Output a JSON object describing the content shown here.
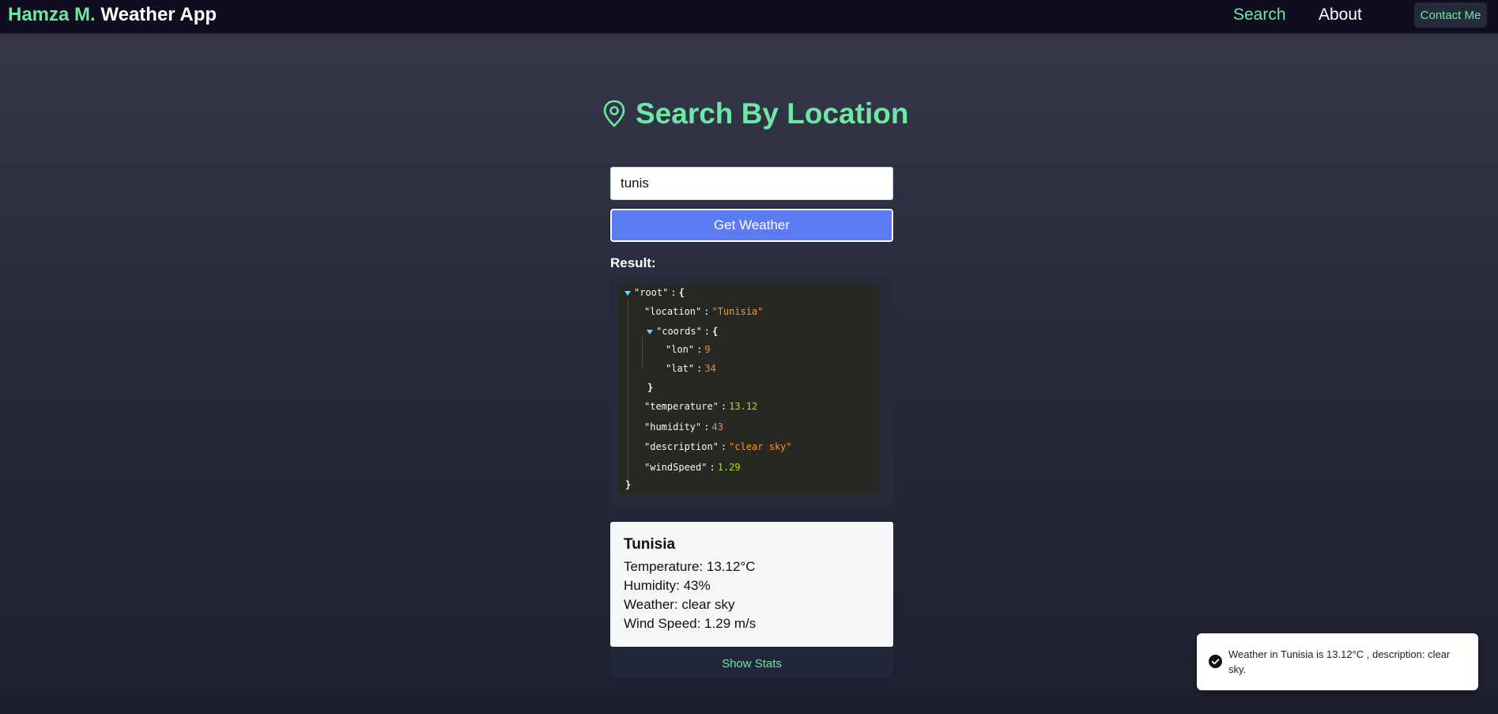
{
  "navbar": {
    "brand_name": "Hamza M.",
    "brand_app": "Weather App",
    "links": [
      "Search",
      "About"
    ],
    "contact_label": "Contact Me"
  },
  "page": {
    "title": "Search By Location",
    "title_icon": "map-pin-icon"
  },
  "search": {
    "value": "tunis",
    "button_label": "Get Weather"
  },
  "result": {
    "label": "Result:",
    "json_lines": {
      "root_key": "\"root\"",
      "location_key": "\"location\"",
      "location_val": "\"Tunisia\"",
      "coords_key": "\"coords\"",
      "lon_key": "\"lon\"",
      "lon_val": "9",
      "lat_key": "\"lat\"",
      "lat_val": "34",
      "temperature_key": "\"temperature\"",
      "temperature_val": "13.12",
      "humidity_key": "\"humidity\"",
      "humidity_val": "43",
      "description_key": "\"description\"",
      "description_val": "\"clear sky\"",
      "windspeed_key": "\"windSpeed\"",
      "windspeed_val": "1.29"
    }
  },
  "weather_card": {
    "location": "Tunisia",
    "temperature": "Temperature: 13.12°C",
    "humidity": "Humidity: 43%",
    "weather": "Weather: clear sky",
    "wind_speed": "Wind Speed: 1.29 m/s",
    "stats_label": "Show Stats"
  },
  "toast": {
    "icon": "check-circle-icon",
    "message": "Weather in Tunisia is 13.12°C , description: clear sky."
  },
  "colors": {
    "accent_green": "#6ee7a4",
    "button_blue": "#5b7bf2",
    "navbar_bg": "#0f0d1f"
  }
}
